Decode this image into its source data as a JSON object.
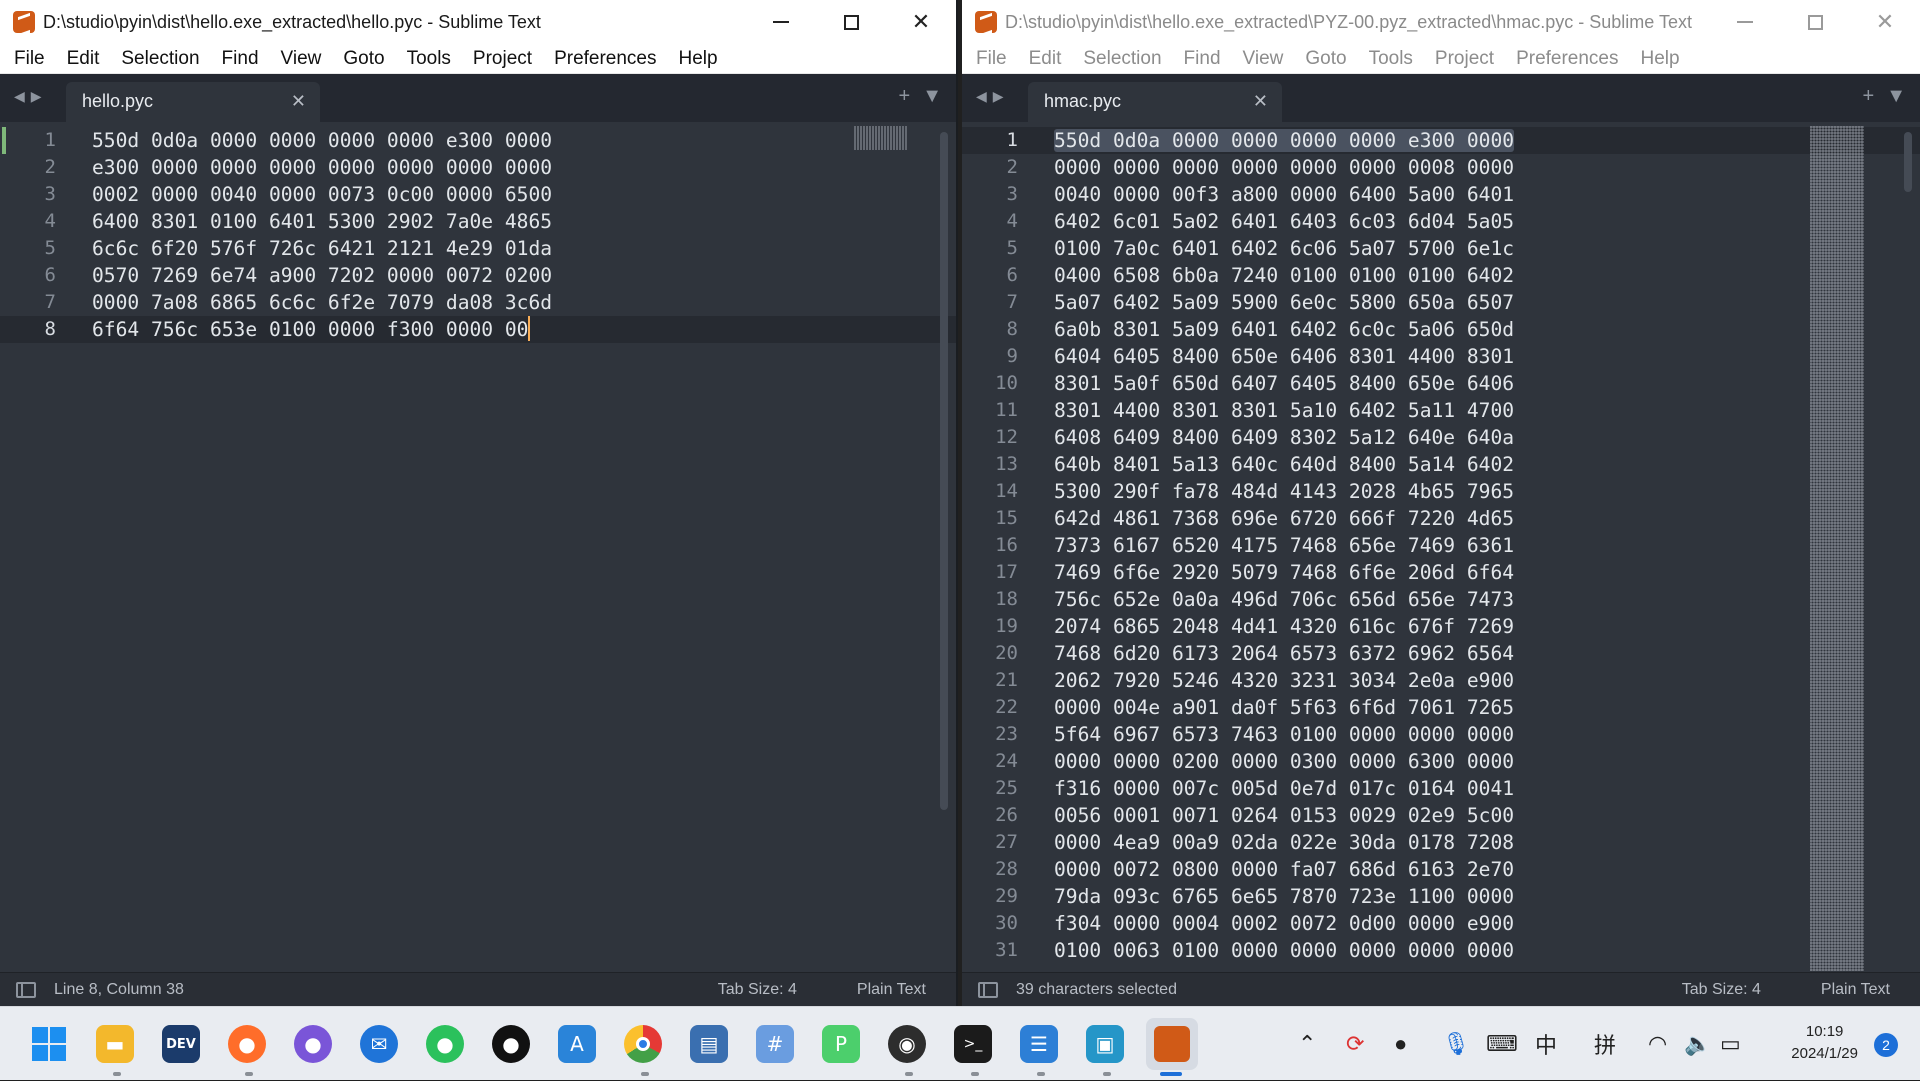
{
  "left_window": {
    "title": "D:\\studio\\pyin\\dist\\hello.exe_extracted\\hello.pyc - Sublime Text",
    "menu": [
      "File",
      "Edit",
      "Selection",
      "Find",
      "View",
      "Goto",
      "Tools",
      "Project",
      "Preferences",
      "Help"
    ],
    "tab_label": "hello.pyc",
    "lines": [
      "550d 0d0a 0000 0000 0000 0000 e300 0000",
      "e300 0000 0000 0000 0000 0000 0000 0000",
      "0002 0000 0040 0000 0073 0c00 0000 6500",
      "6400 8301 0100 6401 5300 2902 7a0e 4865",
      "6c6c 6f20 576f 726c 6421 2121 4e29 01da",
      "0570 7269 6e74 a900 7202 0000 0072 0200",
      "0000 7a08 6865 6c6c 6f2e 7079 da08 3c6d",
      "6f64 756c 653e 0100 0000 f300 0000 00"
    ],
    "line_numbers": [
      "1",
      "2",
      "3",
      "4",
      "5",
      "6",
      "7",
      "8"
    ],
    "current_line": 8,
    "status_left": "Line 8, Column 38",
    "tab_size": "Tab Size: 4",
    "syntax": "Plain Text"
  },
  "right_window": {
    "title": "D:\\studio\\pyin\\dist\\hello.exe_extracted\\PYZ-00.pyz_extracted\\hmac.pyc - Sublime Text",
    "menu": [
      "File",
      "Edit",
      "Selection",
      "Find",
      "View",
      "Goto",
      "Tools",
      "Project",
      "Preferences",
      "Help"
    ],
    "tab_label": "hmac.pyc",
    "lines": [
      "550d 0d0a 0000 0000 0000 0000 e300 0000",
      "0000 0000 0000 0000 0000 0000 0008 0000",
      "0040 0000 00f3 a800 0000 6400 5a00 6401",
      "6402 6c01 5a02 6401 6403 6c03 6d04 5a05",
      "0100 7a0c 6401 6402 6c06 5a07 5700 6e1c",
      "0400 6508 6b0a 7240 0100 0100 0100 6402",
      "5a07 6402 5a09 5900 6e0c 5800 650a 6507",
      "6a0b 8301 5a09 6401 6402 6c0c 5a06 650d",
      "6404 6405 8400 650e 6406 8301 4400 8301",
      "8301 5a0f 650d 6407 6405 8400 650e 6406",
      "8301 4400 8301 8301 5a10 6402 5a11 4700",
      "6408 6409 8400 6409 8302 5a12 640e 640a",
      "640b 8401 5a13 640c 640d 8400 5a14 6402",
      "5300 290f fa78 484d 4143 2028 4b65 7965",
      "642d 4861 7368 696e 6720 666f 7220 4d65",
      "7373 6167 6520 4175 7468 656e 7469 6361",
      "7469 6f6e 2920 5079 7468 6f6e 206d 6f64",
      "756c 652e 0a0a 496d 706c 656d 656e 7473",
      "2074 6865 2048 4d41 4320 616c 676f 7269",
      "7468 6d20 6173 2064 6573 6372 6962 6564",
      "2062 7920 5246 4320 3231 3034 2e0a e900",
      "0000 004e a901 da0f 5f63 6f6d 7061 7265",
      "5f64 6967 6573 7463 0100 0000 0000 0000",
      "0000 0000 0200 0000 0300 0000 6300 0000",
      "f316 0000 007c 005d 0e7d 017c 0164 0041",
      "0056 0001 0071 0264 0153 0029 02e9 5c00",
      "0000 4ea9 00a9 02da 022e 30da 0178 7208",
      "0000 0072 0800 0000 fa07 686d 6163 2e70",
      "79da 093c 6765 6e65 7870 723e 1100 0000",
      "f304 0000 0004 0002 0072 0d00 0000 e900",
      "0100 0063 0100 0000 0000 0000 0000 0000"
    ],
    "line_numbers": [
      "1",
      "2",
      "3",
      "4",
      "5",
      "6",
      "7",
      "8",
      "9",
      "10",
      "11",
      "12",
      "13",
      "14",
      "15",
      "16",
      "17",
      "18",
      "19",
      "20",
      "21",
      "22",
      "23",
      "24",
      "25",
      "26",
      "27",
      "28",
      "29",
      "30",
      "31"
    ],
    "current_line": 1,
    "status_left": "39 characters selected",
    "tab_size": "Tab Size: 4",
    "syntax": "Plain Text"
  },
  "taskbar": {
    "icons": [
      "windows-start-icon",
      "file-explorer-icon",
      "devcpp-icon",
      "firefox-icon",
      "firefox-nightly-icon",
      "thunderbird-icon",
      "wechat-icon",
      "qq-icon",
      "dictionary-icon",
      "chrome-icon",
      "python-icon",
      "network-app-icon",
      "pycharm-icon",
      "obs-icon",
      "terminal-icon",
      "notepad-icon",
      "remote-desktop-icon",
      "sublime-text-icon"
    ],
    "tray_ime_1": "中",
    "tray_ime_2": "拼",
    "time": "10:19",
    "date": "2024/1/29",
    "notification_count": "2"
  },
  "colors": {
    "editor_bg": "#2f343c",
    "tab_bar_bg": "#242830",
    "caret": "#f9ae58",
    "sublime_orange": "#d05a17"
  }
}
